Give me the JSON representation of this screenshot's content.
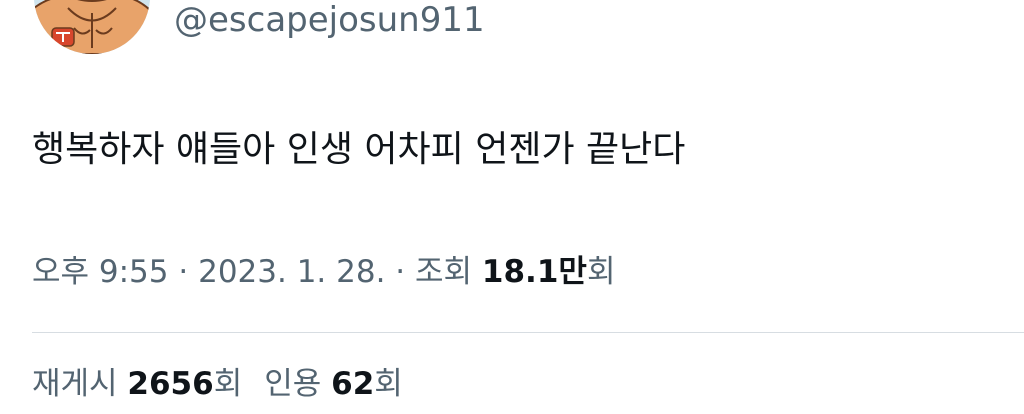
{
  "author": {
    "handle": "@escapejosun911",
    "avatar_icon": "cartoon-avatar-icon"
  },
  "tweet": {
    "text": "행복하자 얘들아 인생 어차피 언젠가 끝난다"
  },
  "meta": {
    "time": "오후 9:55",
    "separator": "·",
    "date": "2023. 1. 28.",
    "views_label": "조회",
    "views_number": "18.1",
    "views_unit": "만",
    "views_suffix": "회"
  },
  "stats": {
    "retweets_label": "재게시",
    "retweets_count": "2656",
    "retweets_suffix": "회",
    "quotes_label": "인용",
    "quotes_count": "62",
    "quotes_suffix": "회"
  },
  "colors": {
    "text_primary": "#0f1419",
    "text_secondary": "#536471",
    "divider": "#d7dde2"
  }
}
